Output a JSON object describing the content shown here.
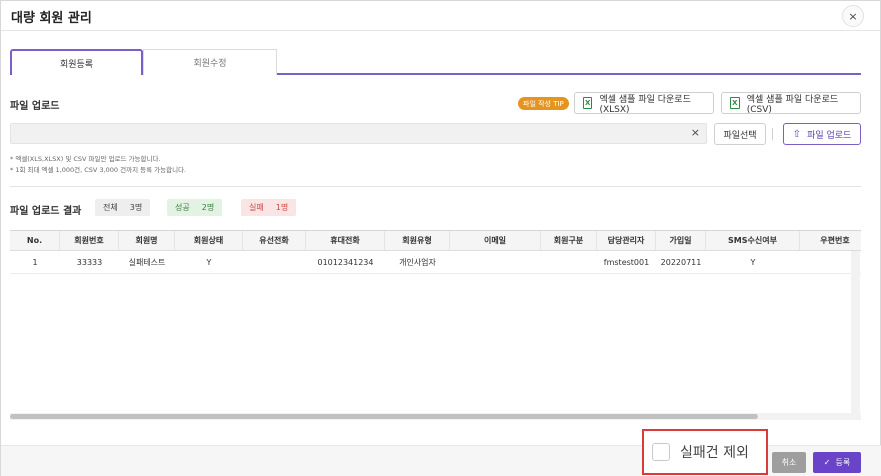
{
  "modal": {
    "title": "대량 회원 관리",
    "close_icon": "×"
  },
  "tabs": [
    {
      "label": "회원등록",
      "active": true
    },
    {
      "label": "회원수정",
      "active": false
    }
  ],
  "upload": {
    "section_label": "파일 업로드",
    "tip_badge": "파일 작성 TIP",
    "download_xlsx_label": "엑셀 샘플 파일 다운로드(XLSX)",
    "download_csv_label": "엑셀 샘플 파일 다운로드(CSV)",
    "file_value": "",
    "clear_icon": "×",
    "select_label": "파일선택",
    "upload_label": "파일 업로드",
    "upload_icon": "⇧",
    "notes": [
      "* 엑셀(XLS,XLSX) 및 CSV 파일만 업로드 가능합니다.",
      "* 1회 최대 엑셀 1,000건, CSV 3,000 건까지 등록 가능합니다."
    ]
  },
  "result": {
    "section_label": "파일 업로드 결과",
    "total": {
      "label": "전체",
      "count": "3명"
    },
    "success": {
      "label": "성공",
      "count": "2명"
    },
    "fail": {
      "label": "실패",
      "count": "1명"
    }
  },
  "table": {
    "columns": [
      "No.",
      "회원번호",
      "회원명",
      "회원상태",
      "유선전화",
      "휴대전화",
      "회원유형",
      "이메일",
      "회원구분",
      "담당관리자",
      "가입일",
      "SMS수신여부",
      "우편번호"
    ],
    "rows": [
      [
        "1",
        "33333",
        "실패테스트",
        "Y",
        "",
        "01012341234",
        "개인사업자",
        "",
        "",
        "fmstest001",
        "20220711",
        "Y",
        ""
      ]
    ]
  },
  "footer": {
    "exclude_label": "실패건 제외",
    "exclude_checked": false,
    "cancel_label": "취소",
    "submit_label": "등록",
    "submit_icon": "✓"
  },
  "colors": {
    "accent": "#6a44c8",
    "tip": "#e69420",
    "success_bg": "#e3f3e3",
    "fail_bg": "#fbe4e4",
    "highlight_border": "#d93a3a"
  }
}
